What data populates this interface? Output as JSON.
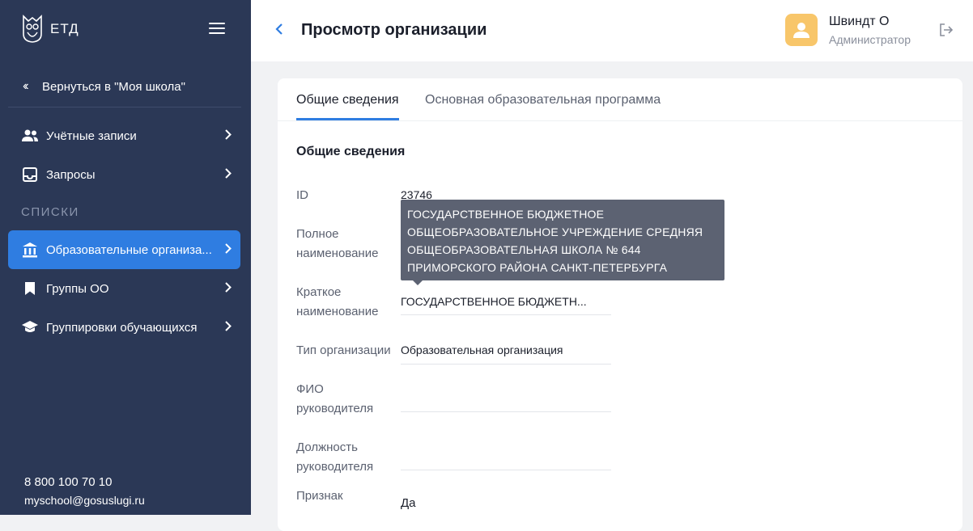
{
  "sidebar": {
    "logo_text": "ЕТД",
    "back_label": "Вернуться в \"Моя школа\"",
    "items": [
      {
        "label": "Учётные записи",
        "icon": "users-icon"
      },
      {
        "label": "Запросы",
        "icon": "inbox-icon"
      },
      {
        "label": "Образовательные организа...",
        "icon": "institution-icon",
        "active": true
      },
      {
        "label": "Группы ОО",
        "icon": "bookmark-icon"
      },
      {
        "label": "Группировки обучающихся",
        "icon": "school-cap-icon"
      }
    ],
    "section_label": "СПИСКИ",
    "phone": "8 800 100 70 10",
    "email": "myschool@gosuslugi.ru"
  },
  "header": {
    "title": "Просмотр организации",
    "user_name": "Швиндт О",
    "user_role": "Администратор"
  },
  "tabs": [
    {
      "label": "Общие сведения",
      "active": true
    },
    {
      "label": "Основная образовательная программа",
      "active": false
    }
  ],
  "section_title": "Общие сведения",
  "fields": {
    "id_label": "ID",
    "id_value": "23746",
    "full_name_label_1": "Полное",
    "full_name_label_2": "наименование",
    "short_name_label_1": "Краткое",
    "short_name_label_2": "наименование",
    "short_name_value": "ГОСУДАРСТВЕННОЕ БЮДЖЕТН...",
    "org_type_label": "Тип организации",
    "org_type_value": "Образовательная организация",
    "head_name_label_1": "ФИО",
    "head_name_label_2": "руководителя",
    "head_name_value": "",
    "head_position_label_1": "Должность",
    "head_position_label_2": "руководителя",
    "head_position_value": "",
    "flag_label": "Признак",
    "flag_value": "Да"
  },
  "tooltip": {
    "line1": "ГОСУДАРСТВЕННОЕ БЮДЖЕТНОЕ",
    "line2": "ОБЩЕОБРАЗОВАТЕЛЬНОЕ УЧРЕЖДЕНИЕ СРЕДНЯЯ",
    "line3": "ОБЩЕОБРАЗОВАТЕЛЬНАЯ ШКОЛА № 644",
    "line4": "ПРИМОРСКОГО РАЙОНА САНКТ-ПЕТЕРБУРГА"
  },
  "colors": {
    "sidebar_bg": "#2b3856",
    "accent": "#2f7de1",
    "avatar_bg": "#f8c66a",
    "tooltip_bg": "#5c6272"
  }
}
